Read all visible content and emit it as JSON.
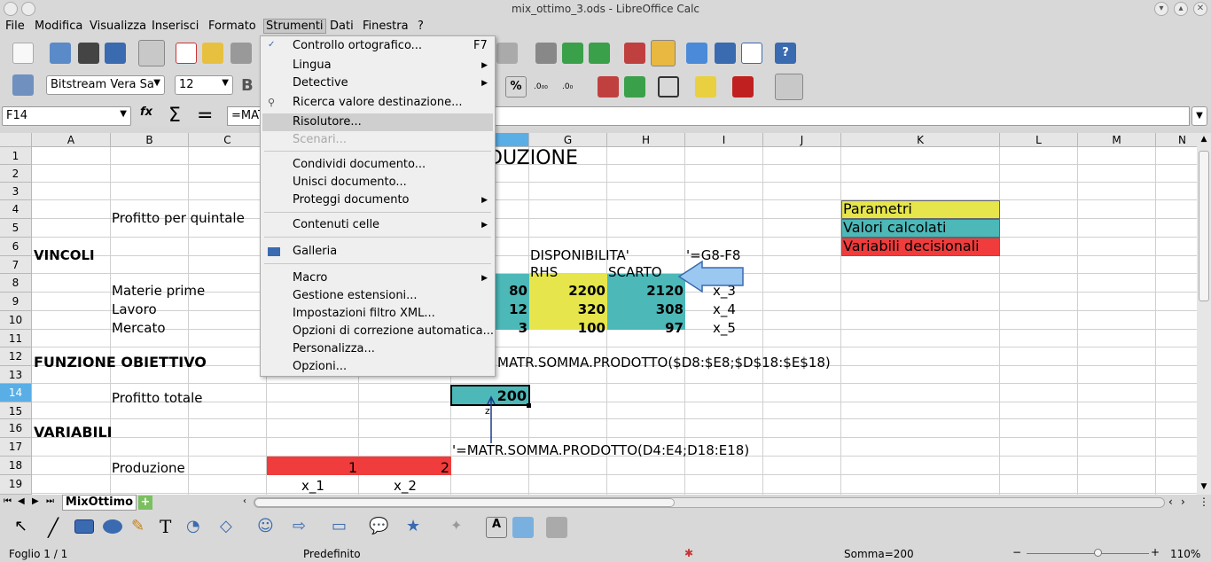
{
  "window": {
    "title": "mix_ottimo_3.ods - LibreOffice Calc"
  },
  "menubar": [
    "File",
    "Modifica",
    "Visualizza",
    "Inserisci",
    "Formato",
    "Strumenti",
    "Dati",
    "Finestra",
    "?"
  ],
  "font": {
    "name": "Bitstream Vera Sa",
    "size": "12"
  },
  "formula": {
    "cellref": "F14",
    "content": "=MAT"
  },
  "columns": [
    "A",
    "B",
    "C",
    "D",
    "E",
    "F",
    "G",
    "H",
    "I",
    "J",
    "K",
    "L",
    "M",
    "N"
  ],
  "rows": [
    "1",
    "2",
    "3",
    "4",
    "5",
    "6",
    "7",
    "8",
    "9",
    "10",
    "11",
    "12",
    "13",
    "14",
    "15",
    "16",
    "17",
    "18",
    "19"
  ],
  "cells": {
    "title": "DUZIONE",
    "b4": "Profitto per quintale",
    "a6": "VINCOLI",
    "g6": "DISPONIBILITA'",
    "i6": "'=G8-F8",
    "g7": "RHS",
    "h7": "SCARTO",
    "b8": "Materie prime",
    "f8": "80",
    "g8": "2200",
    "h8": "2120",
    "i8": "x_3",
    "b9": "Lavoro",
    "f9": "12",
    "g9": "320",
    "h9": "308",
    "i9": "x_4",
    "b10": "Mercato",
    "f10": "3",
    "g10": "100",
    "h10": "97",
    "i10": "x_5",
    "a12": "FUNZIONE OBIETTIVO",
    "f12": "MATR.SOMMA.PRODOTTO($D8:$E8;$D$18:$E$18)",
    "b14": "Profitto totale",
    "f14": "200",
    "f15": "z",
    "a16": "VARIABILI",
    "f17": "'=MATR.SOMMA.PRODOTTO(D4:E4;D18:E18)",
    "b18": "Produzione",
    "d18": "1",
    "e18": "2",
    "d19": "x_1",
    "e19": "x_2",
    "k4": "Parametri",
    "k5": "Valori calcolati",
    "k6": "Variabili decisionali"
  },
  "menu": {
    "items": [
      {
        "label": "Controllo ortografico...",
        "shortcut": "F7"
      },
      {
        "label": "Lingua"
      },
      {
        "label": "Detective"
      },
      {
        "label": "Ricerca valore destinazione..."
      },
      {
        "label": "Risolutore..."
      },
      {
        "label": "Scenari..."
      },
      {
        "label": "Condividi documento..."
      },
      {
        "label": "Unisci documento..."
      },
      {
        "label": "Proteggi documento"
      },
      {
        "label": "Contenuti celle"
      },
      {
        "label": "Galleria"
      },
      {
        "label": "Macro"
      },
      {
        "label": "Gestione estensioni..."
      },
      {
        "label": "Impostazioni filtro XML..."
      },
      {
        "label": "Opzioni di correzione automatica..."
      },
      {
        "label": "Personalizza..."
      },
      {
        "label": "Opzioni..."
      }
    ]
  },
  "sheet": {
    "tab": "MixOttimo"
  },
  "status": {
    "sheet": "Foglio 1 / 1",
    "style": "Predefinito",
    "sum": "Somma=200",
    "zoom": "110%"
  },
  "colors": {
    "yellow": "#e6e64c",
    "teal": "#4cb8b8",
    "red": "#f03c3c",
    "select": "#5aaee6"
  }
}
